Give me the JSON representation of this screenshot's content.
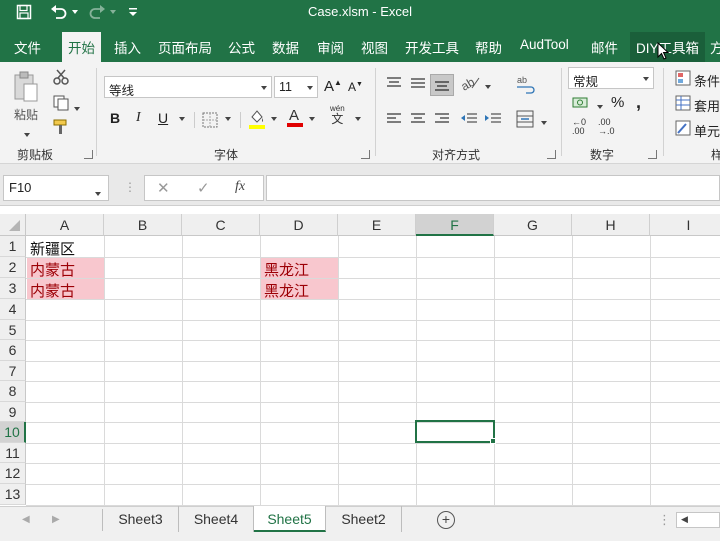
{
  "title_bar": {
    "title": "Case.xlsm  -  Excel"
  },
  "tabs": [
    {
      "label": "文件"
    },
    {
      "label": "开始"
    },
    {
      "label": "插入"
    },
    {
      "label": "页面布局"
    },
    {
      "label": "公式"
    },
    {
      "label": "数据"
    },
    {
      "label": "审阅"
    },
    {
      "label": "视图"
    },
    {
      "label": "开发工具"
    },
    {
      "label": "帮助"
    },
    {
      "label": "AudTool"
    },
    {
      "label": "邮件"
    },
    {
      "label": "DIY工具箱"
    },
    {
      "label": "方"
    }
  ],
  "ribbon": {
    "clipboard": {
      "paste_label": "粘贴",
      "group_label": "剪贴板"
    },
    "font": {
      "font_name": "等线",
      "font_size": "11",
      "bold": "B",
      "italic": "I",
      "underline": "U",
      "grow": "A",
      "shrink": "A",
      "phonetic_top": "wén",
      "phonetic_bottom": "文",
      "group_label": "字体"
    },
    "alignment": {
      "group_label": "对齐方式"
    },
    "number": {
      "format": "常规",
      "percent": "%",
      "comma": ",",
      "inc_decimal_top": "←0",
      "inc_decimal_bottom": ".00",
      "dec_decimal_top": ".00",
      "dec_decimal_bottom": "→.0",
      "group_label": "数字"
    },
    "styles": {
      "conditional": "条件",
      "table": "套用",
      "cell": "单元",
      "group_label": "样"
    }
  },
  "formula_bar": {
    "name_box": "F10",
    "cancel": "✕",
    "enter": "✓",
    "fx": "fx",
    "value": ""
  },
  "columns": [
    "A",
    "B",
    "C",
    "D",
    "E",
    "F",
    "G",
    "H",
    "I"
  ],
  "rows": [
    "1",
    "2",
    "3",
    "4",
    "5",
    "6",
    "7",
    "8",
    "9",
    "10",
    "11",
    "12",
    "13"
  ],
  "cells": {
    "A1": "新疆区",
    "A2": "内蒙古",
    "A3": "内蒙古",
    "D2": "黑龙江",
    "D3": "黑龙江"
  },
  "sheet_tabs": [
    {
      "label": "Sheet3"
    },
    {
      "label": "Sheet4"
    },
    {
      "label": "Sheet5"
    },
    {
      "label": "Sheet2"
    }
  ],
  "add_sheet": "+",
  "colors": {
    "excel_green": "#217346",
    "duplicate_fill": "#f8c7ce",
    "duplicate_text": "#9c0006"
  }
}
